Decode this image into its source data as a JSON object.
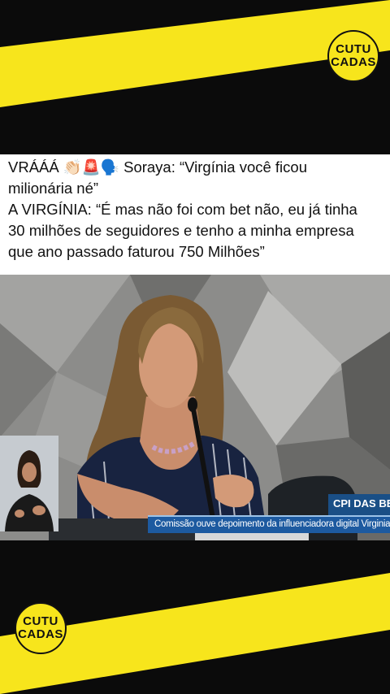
{
  "brand": {
    "logo_line1": "CUTU",
    "logo_line2": "CADAS",
    "accent_yellow": "#f7e51c"
  },
  "caption": {
    "line1": "VRÁÁÁ 👏🏻🚨🗣️ Soraya: “Virgínia você ficou",
    "line2": "milionária né”",
    "line3": "A VIRGÍNIA: “É mas não foi com bet não, eu já tinha",
    "line4": "30 milhões de seguidores e tenho a minha empresa",
    "line5": "que ano passado faturou 750 Milhões”"
  },
  "video": {
    "program_title": "CPI DAS BET",
    "lower_third_text": "Comissão ouve depoimento da influenciadora digital Virginia For"
  }
}
